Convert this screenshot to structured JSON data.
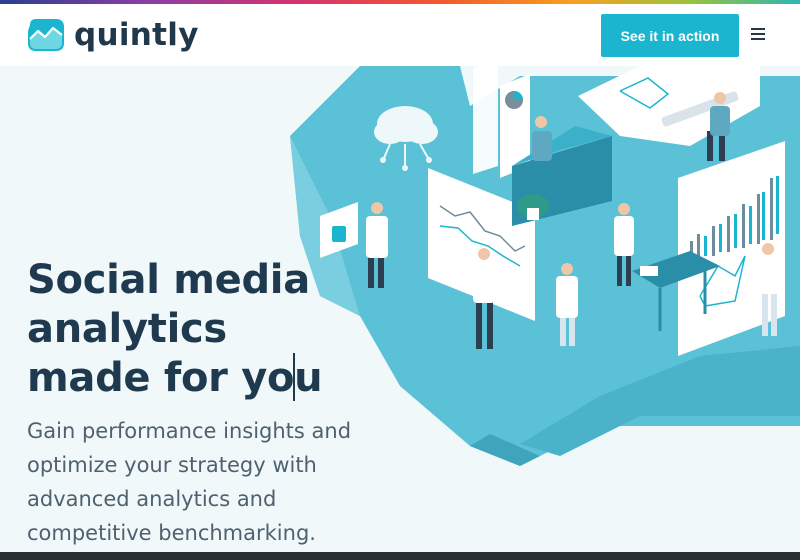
{
  "brand": {
    "name": "quintly",
    "logo_icon": "wave-chart-logo-icon"
  },
  "header": {
    "cta_label": "See it in action",
    "menu_icon": "hamburger-menu-icon"
  },
  "hero": {
    "headline": "Social media analytics made for you",
    "subtext": "Gain performance insights and optimize your strategy with advanced analytics and competitive benchmarking."
  },
  "colors": {
    "accent": "#1bb5cf",
    "heading": "#1f3a4f",
    "body_text": "#4f6170",
    "background": "#f1f8f9",
    "illustration_teal": "#5bc1d6"
  }
}
